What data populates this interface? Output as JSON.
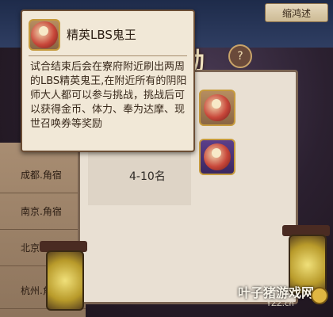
{
  "window": {
    "top_right_label": "缩鸿述",
    "banner_title": "励",
    "banner_close": "?"
  },
  "popup": {
    "title": "精英LBS鬼王",
    "icon": "ghost-king-icon",
    "description": "试合结束后会在寮府附近刷出两周的LBS精英鬼王,在附近所有的阴阳师大人都可以参与挑战，挑战后可以获得金币、体力、奉为达摩、现世召唤券等奖励"
  },
  "ranks": {
    "rank_label": "4-10名"
  },
  "rewards": [
    {
      "icon": "ghost-king-reward-icon",
      "bg": "#b68d60"
    },
    {
      "icon": "purple-ghost-reward-icon",
      "bg": "#5b3f8a"
    }
  ],
  "left_list": {
    "rows": [
      "成都.角宿",
      "南京.角宿",
      "北京",
      "杭州.角"
    ]
  },
  "watermark": {
    "brand": "叶子猪游戏网",
    "url": "YZZ.cn"
  }
}
